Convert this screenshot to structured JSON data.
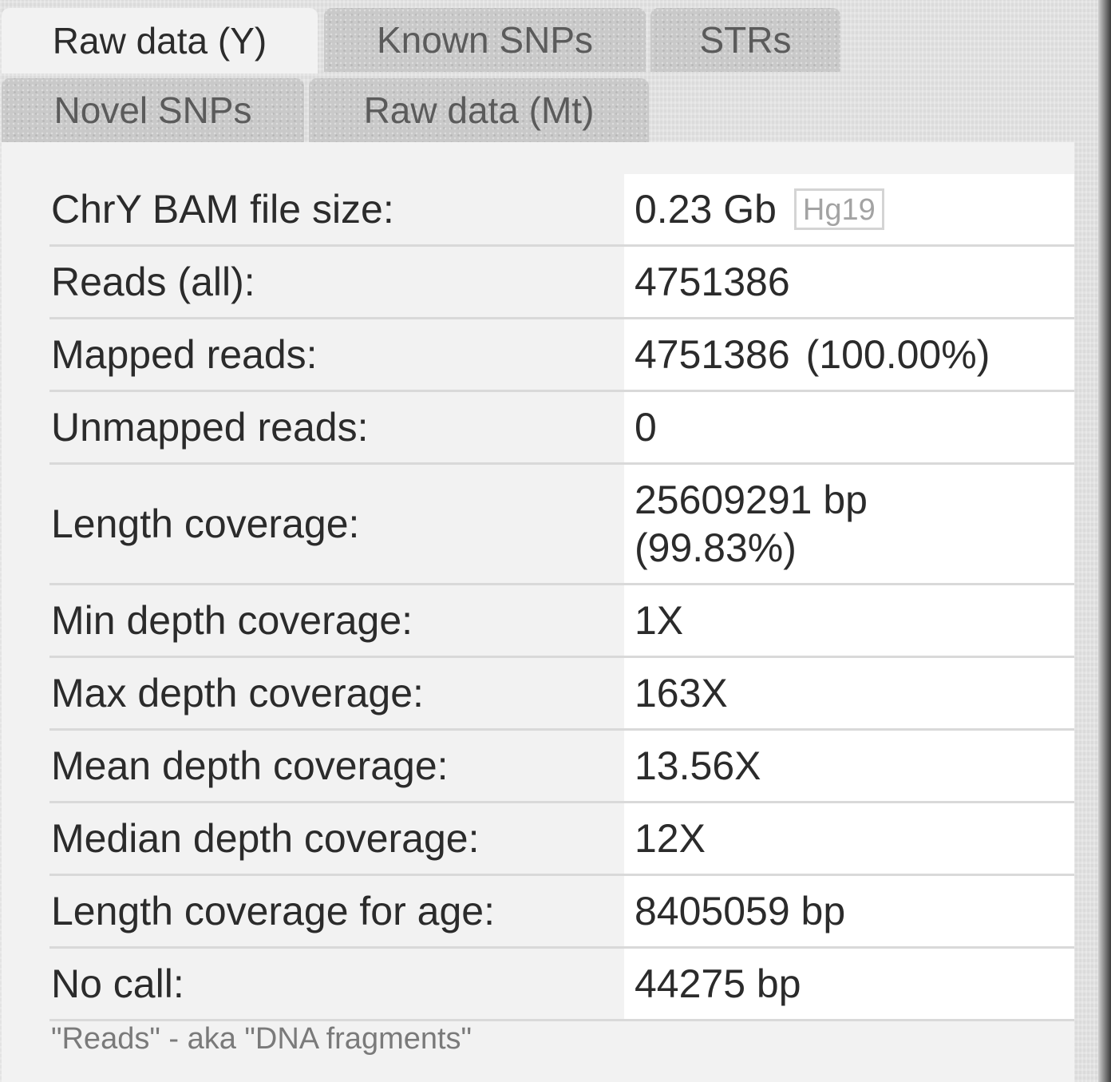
{
  "tabs": [
    {
      "label": "Raw data (Y)",
      "active": true
    },
    {
      "label": "Known SNPs",
      "active": false
    },
    {
      "label": "STRs",
      "active": false
    },
    {
      "label": "Novel SNPs",
      "active": false
    },
    {
      "label": "Raw data (Mt)",
      "active": false
    }
  ],
  "stats": {
    "bam_size": {
      "label": "ChrY BAM file size:",
      "value": "0.23 Gb",
      "badge": "Hg19"
    },
    "reads_all": {
      "label": "Reads (all):",
      "value": "4751386"
    },
    "mapped_reads": {
      "label": "Mapped reads:",
      "value": "4751386",
      "percent": "(100.00%)"
    },
    "unmapped_reads": {
      "label": "Unmapped reads:",
      "value": "0"
    },
    "length_coverage": {
      "label": "Length coverage:",
      "value": "25609291 bp (99.83%)"
    },
    "min_depth": {
      "label": "Min depth coverage:",
      "value": "1X"
    },
    "max_depth": {
      "label": "Max depth coverage:",
      "value": "163X"
    },
    "mean_depth": {
      "label": "Mean depth coverage:",
      "value": "13.56X"
    },
    "median_depth": {
      "label": "Median depth coverage:",
      "value": "12X"
    },
    "length_coverage_age": {
      "label": "Length coverage for age:",
      "value": "8405059 bp"
    },
    "no_call": {
      "label": "No call:",
      "value": "44275 bp"
    }
  },
  "footnote": "\"Reads\" - aka \"DNA fragments\"",
  "colors": {
    "panel_bg": "#f2f2f2",
    "tab_inactive_bg": "#c9c9c9",
    "text": "#2b2b2b",
    "muted_text": "#7a7a7a",
    "row_divider": "#d9d9d9"
  }
}
